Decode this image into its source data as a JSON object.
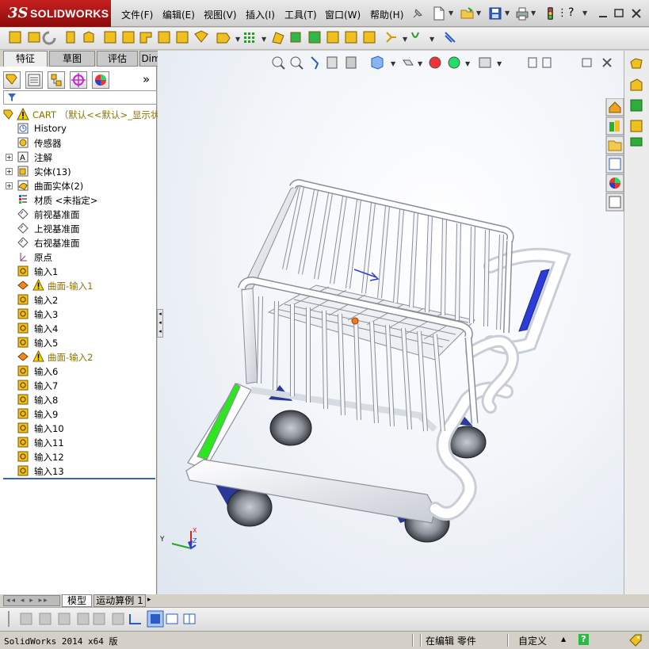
{
  "app": {
    "logo_ds": "3S",
    "logo_name": "SOLIDWORKS"
  },
  "menu": [
    "文件(F)",
    "编辑(E)",
    "视图(V)",
    "插入(I)",
    "工具(T)",
    "窗口(W)",
    "帮助(H)"
  ],
  "help_icon": "?",
  "tabs": [
    "特征",
    "草图",
    "评估",
    "DimXpert"
  ],
  "active_tab": "特征",
  "panel_expand": "»",
  "tree": {
    "root": "CART  （默认<<默认>_显示状态",
    "items": [
      {
        "label": "History",
        "icon": "history-icon",
        "expandable": false
      },
      {
        "label": "传感器",
        "icon": "sensor-icon",
        "expandable": false
      },
      {
        "label": "注解",
        "icon": "annotation-icon",
        "expandable": true
      },
      {
        "label": "实体(13)",
        "icon": "solid-bodies-icon",
        "expandable": true
      },
      {
        "label": "曲面实体(2)",
        "icon": "surface-bodies-icon",
        "expandable": true
      },
      {
        "label": "材质 <未指定>",
        "icon": "material-icon",
        "expandable": false
      },
      {
        "label": "前视基准面",
        "icon": "plane-icon",
        "expandable": false
      },
      {
        "label": "上视基准面",
        "icon": "plane-icon",
        "expandable": false
      },
      {
        "label": "右视基准面",
        "icon": "plane-icon",
        "expandable": false
      },
      {
        "label": "原点",
        "icon": "origin-icon",
        "expandable": false
      },
      {
        "label": "输入1",
        "icon": "import-icon",
        "expandable": false
      },
      {
        "label": "曲面-输入1",
        "icon": "surface-warning-icon",
        "expandable": false,
        "warning": true
      },
      {
        "label": "输入2",
        "icon": "import-icon",
        "expandable": false
      },
      {
        "label": "输入3",
        "icon": "import-icon",
        "expandable": false
      },
      {
        "label": "输入4",
        "icon": "import-icon",
        "expandable": false
      },
      {
        "label": "输入5",
        "icon": "import-icon",
        "expandable": false
      },
      {
        "label": "曲面-输入2",
        "icon": "surface-warning-icon",
        "expandable": false,
        "warning": true
      },
      {
        "label": "输入6",
        "icon": "import-icon",
        "expandable": false
      },
      {
        "label": "输入7",
        "icon": "import-icon",
        "expandable": false
      },
      {
        "label": "输入8",
        "icon": "import-icon",
        "expandable": false
      },
      {
        "label": "输入9",
        "icon": "import-icon",
        "expandable": false
      },
      {
        "label": "输入10",
        "icon": "import-icon",
        "expandable": false
      },
      {
        "label": "输入11",
        "icon": "import-icon",
        "expandable": false
      },
      {
        "label": "输入12",
        "icon": "import-icon",
        "expandable": false
      },
      {
        "label": "输入13",
        "icon": "import-icon",
        "expandable": false
      }
    ]
  },
  "bottom_tabs": [
    "模型",
    "运动算例 1"
  ],
  "triad": {
    "x": "X",
    "y": "Y",
    "z": "Z"
  },
  "status": {
    "app_version": "SolidWorks 2014 x64 版",
    "editing": "在编辑 零件",
    "units": "自定义",
    "help": "?"
  },
  "colors": {
    "accent_red": "#b31515",
    "selection_blue": "#2b3dd6",
    "highlight_green": "#2ee61f"
  }
}
